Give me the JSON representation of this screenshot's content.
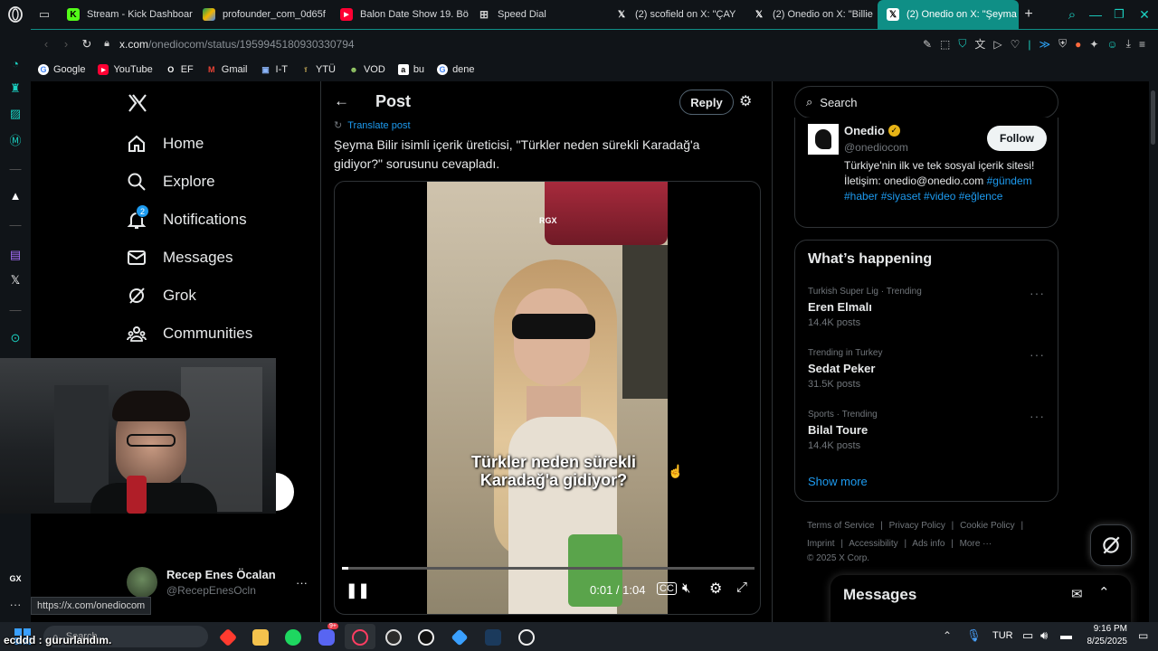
{
  "tabs": [
    {
      "label": "Stream - Kick Dashboar",
      "icon": "kick-icon",
      "color": "#53fc18"
    },
    {
      "label": "profounder_com_0d65f",
      "icon": "drive-icon",
      "color": "#f4b400"
    },
    {
      "label": "Balon Date Show 19. Bö",
      "icon": "youtube-icon",
      "color": "#ff0033"
    },
    {
      "label": "Speed Dial",
      "icon": "grid-icon",
      "color": "#cccccc"
    },
    {
      "label": "(2) scofield on X: \"ÇAY",
      "icon": "x-icon",
      "color": "#ffffff"
    },
    {
      "label": "(2) Onedio on X: \"Billie",
      "icon": "x-icon",
      "color": "#ffffff"
    },
    {
      "label": "(2) Onedio on X: \"Şeyma",
      "icon": "x-icon",
      "color": "#ffffff"
    }
  ],
  "address": {
    "host": "x.com",
    "path": "/onediocom/status/1959945180930330794"
  },
  "bookmarks": [
    {
      "label": "Google",
      "icon": "google-icon",
      "color": "#ffffff"
    },
    {
      "label": "YouTube",
      "icon": "youtube-icon",
      "color": "#ff0033"
    },
    {
      "label": "EF",
      "icon": "ef-icon",
      "color": "#ffffff"
    },
    {
      "label": "Gmail",
      "icon": "gmail-icon",
      "color": "#ea4335"
    },
    {
      "label": "I-T",
      "icon": "folder-icon",
      "color": "#8ab4f8"
    },
    {
      "label": "YTÜ",
      "icon": "ytu-icon",
      "color": "#e0c060"
    },
    {
      "label": "VOD",
      "icon": "vod-icon",
      "color": "#9ad06a"
    },
    {
      "label": "bu",
      "icon": "amazon-icon",
      "color": "#ffffff"
    },
    {
      "label": "dene",
      "icon": "google-icon",
      "color": "#ffffff"
    }
  ],
  "nav": [
    {
      "label": "Home",
      "icon": "home-icon"
    },
    {
      "label": "Explore",
      "icon": "search-icon"
    },
    {
      "label": "Notifications",
      "icon": "bell-icon",
      "badge": "2"
    },
    {
      "label": "Messages",
      "icon": "mail-icon"
    },
    {
      "label": "Grok",
      "icon": "grok-icon"
    },
    {
      "label": "Communities",
      "icon": "communities-icon"
    }
  ],
  "account": {
    "name": "Recep Enes Öcalan",
    "handle": "@RecepEnesOcln"
  },
  "post": {
    "header_title": "Post",
    "reply_label": "Reply",
    "translate_label": "Translate post",
    "text": "Şeyma Bilir isimli içerik üreticisi, \"Türkler neden sürekli Karadağ'a gidiyor?\" sorusunu cevapladı.",
    "video_watermark": "RGX",
    "video_caption_line1": "Türkler neden sürekli",
    "video_caption_line2": "Karadağ'a gidiyor?",
    "video_time": "0:01 / 1:04",
    "progress_fraction": 0.016
  },
  "search": {
    "placeholder": "Search"
  },
  "profile": {
    "name": "Onedio",
    "handle": "@onediocom",
    "follow_label": "Follow",
    "bio_text": "Türkiye'nin ilk ve tek sosyal içerik sitesi! İletişim: onedio@onedio.com",
    "hashtags": "#gündem #haber #siyaset #video #eğlence"
  },
  "happening": {
    "title": "What’s happening",
    "trends": [
      {
        "meta": "Turkish Super Lig · Trending",
        "name": "Eren Elmalı",
        "count": "14.4K posts"
      },
      {
        "meta": "Trending in Turkey",
        "name": "Sedat Peker",
        "count": "31.5K posts"
      },
      {
        "meta": "Sports · Trending",
        "name": "Bilal Toure",
        "count": "14.4K posts"
      }
    ],
    "show_more": "Show more"
  },
  "footer": {
    "row1": [
      "Terms of Service",
      "Privacy Policy",
      "Cookie Policy"
    ],
    "row2": [
      "Imprint",
      "Accessibility",
      "Ads info",
      "More ···"
    ],
    "copyright": "© 2025 X Corp."
  },
  "messages_drawer": {
    "title": "Messages"
  },
  "status_url": "https://x.com/onediocom",
  "overlay_text": "ecddd : gururlandım.",
  "taskbar": {
    "search_placeholder": "Search",
    "language": "TUR",
    "time": "9:16 PM",
    "date": "8/25/2025",
    "discord_badge": "9+"
  },
  "colors": {
    "accent": "#1d9bf0",
    "gx": "#0f8f86",
    "verified": "#e7b416"
  }
}
